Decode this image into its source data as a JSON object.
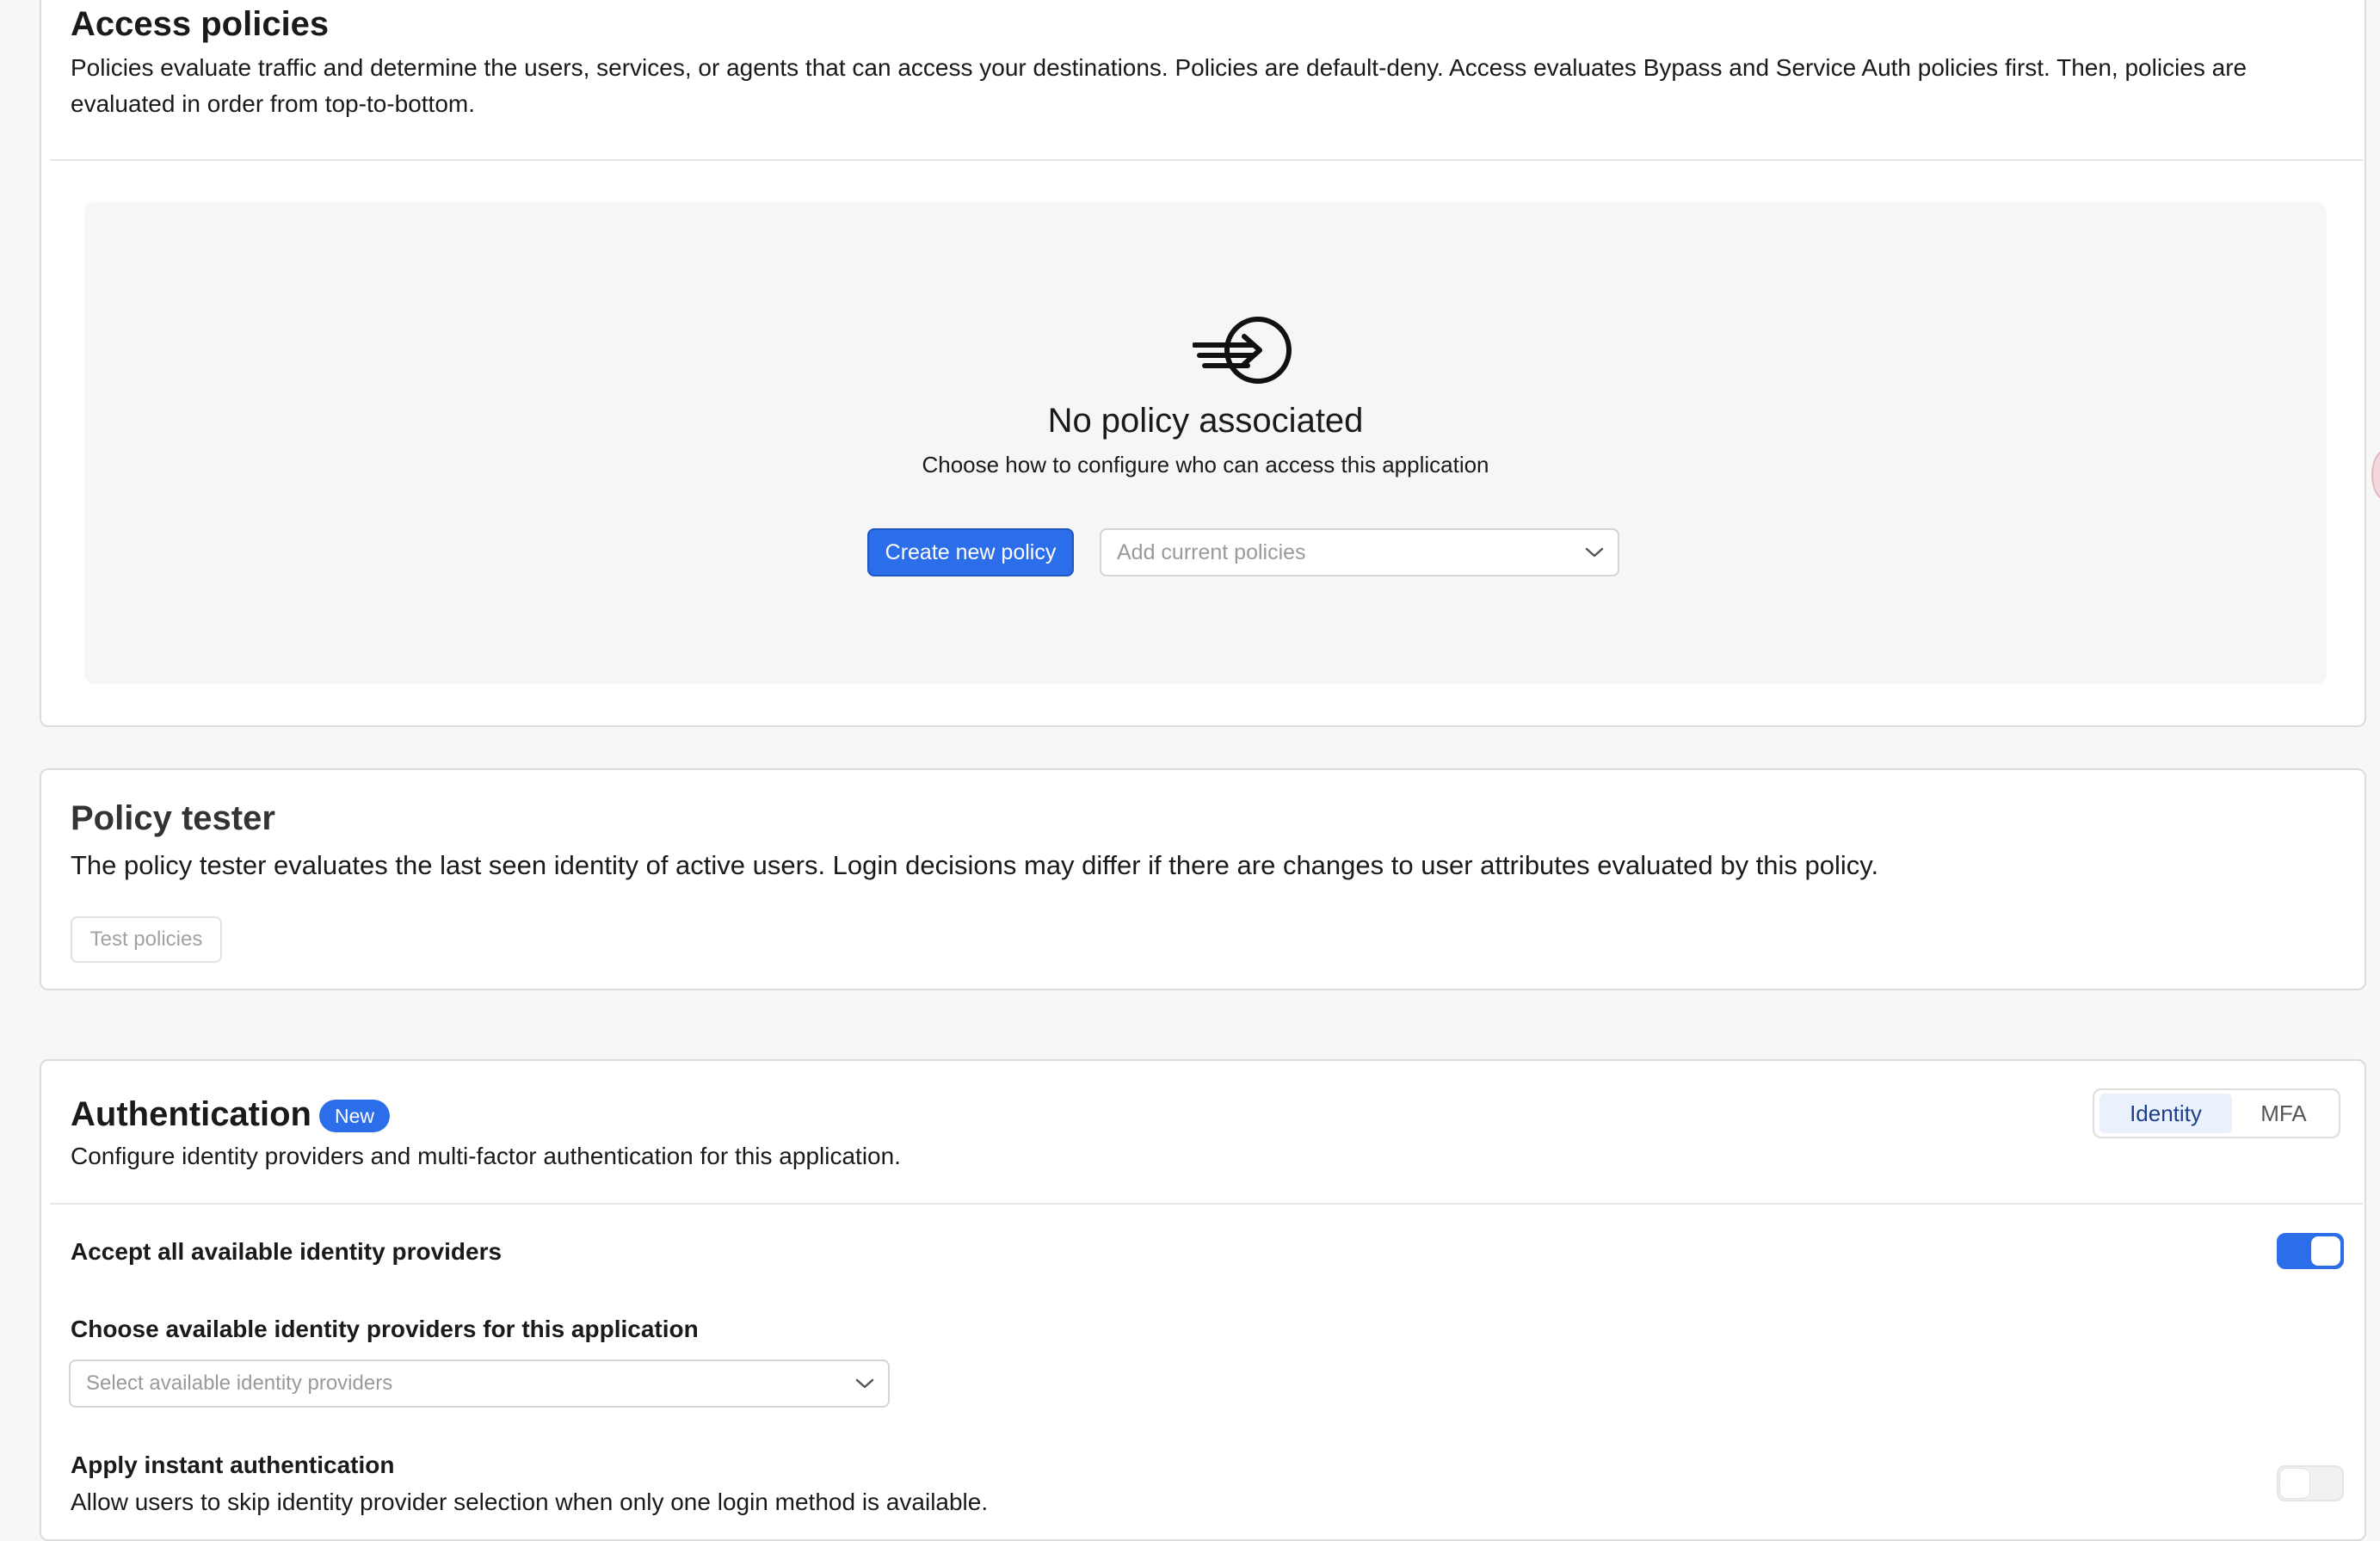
{
  "access_policies": {
    "title": "Access policies",
    "description": "Policies evaluate traffic and determine the users, services, or agents that can access your destinations. Policies are default-deny. Access evaluates Bypass and Service Auth policies first. Then, policies are evaluated in order from top-to-bottom.",
    "empty_state": {
      "icon": "sign-in-icon",
      "title": "No policy associated",
      "subtitle": "Choose how to configure who can access this application"
    },
    "create_button": "Create new policy",
    "add_select_placeholder": "Add current policies"
  },
  "policy_tester": {
    "title": "Policy tester",
    "description": "The policy tester evaluates the last seen identity of active users. Login decisions may differ if there are changes to user attributes evaluated by this policy.",
    "test_button": "Test policies"
  },
  "authentication": {
    "title": "Authentication",
    "badge": "New",
    "description": "Configure identity providers and multi-factor authentication for this application.",
    "tabs": [
      {
        "label": "Identity",
        "selected": true
      },
      {
        "label": "MFA",
        "selected": false
      }
    ],
    "accept_all_label": "Accept all available identity providers",
    "accept_all_enabled": true,
    "choose_label": "Choose available identity providers for this application",
    "idp_select_placeholder": "Select available identity providers",
    "instant_auth_label": "Apply instant authentication",
    "instant_auth_description": "Allow users to skip identity provider selection when only one login method is available.",
    "instant_auth_enabled": false
  },
  "colors": {
    "accent": "#2c6ee9",
    "background": "#f7f7f7"
  }
}
